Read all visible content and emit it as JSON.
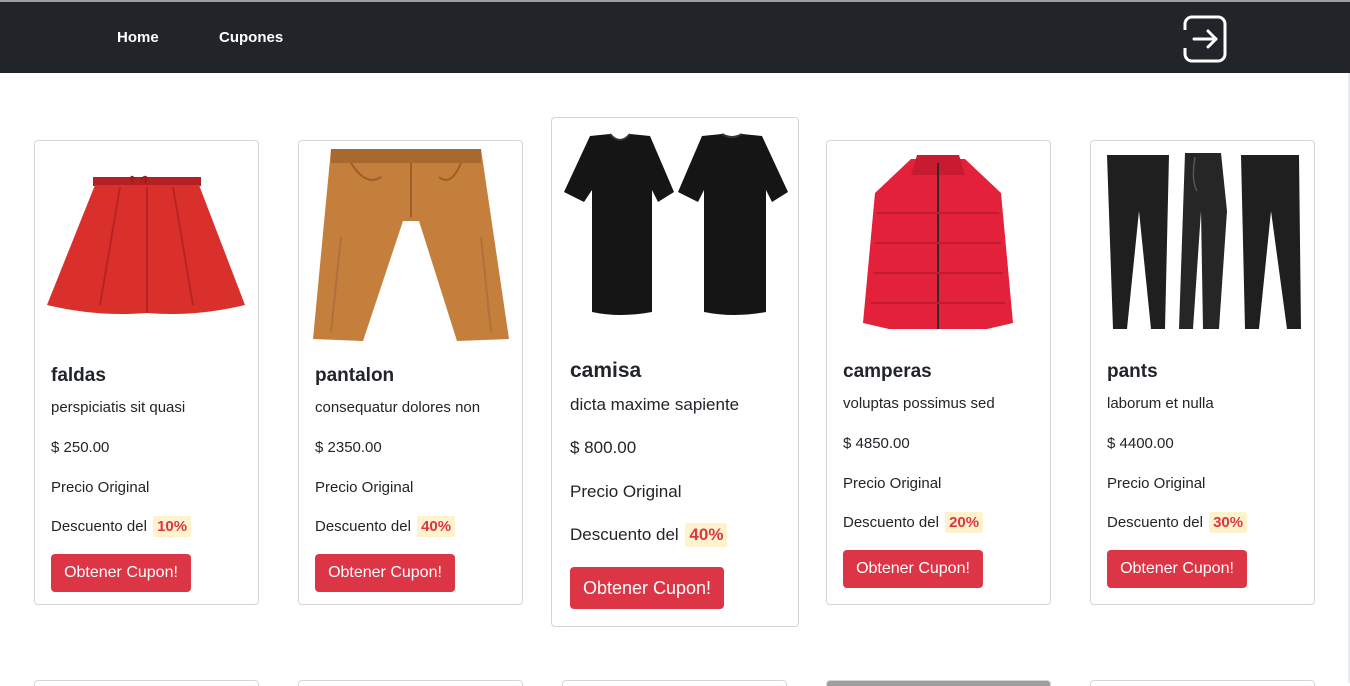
{
  "nav": {
    "home_label": "Home",
    "cupones_label": "Cupones",
    "logout_icon": "logout-icon"
  },
  "colors": {
    "navbar": "#212529",
    "button": "#dc3545",
    "discount_bg": "#fff3cd",
    "discount_text": "#dc3545"
  },
  "products": [
    {
      "title": "faldas",
      "description": "perspiciatis sit quasi",
      "price": "$ 250.00",
      "original": "Precio Original",
      "discount_label": "Descuento del",
      "discount": "10%",
      "button": "Obtener Cupon!",
      "image": "red-skirt"
    },
    {
      "title": "pantalon",
      "description": "consequatur dolores non",
      "price": "$ 2350.00",
      "original": "Precio Original",
      "discount_label": "Descuento del",
      "discount": "40%",
      "button": "Obtener Cupon!",
      "image": "brown-trousers"
    },
    {
      "title": "camisa",
      "description": "dicta maxime sapiente",
      "price": "$ 800.00",
      "original": "Precio Original",
      "discount_label": "Descuento del",
      "discount": "40%",
      "button": "Obtener Cupon!",
      "image": "black-tshirts"
    },
    {
      "title": "camperas",
      "description": "voluptas possimus sed",
      "price": "$ 4850.00",
      "original": "Precio Original",
      "discount_label": "Descuento del",
      "discount": "20%",
      "button": "Obtener Cupon!",
      "image": "red-puffer-jacket"
    },
    {
      "title": "pants",
      "description": "laborum et nulla",
      "price": "$ 4400.00",
      "original": "Precio Original",
      "discount_label": "Descuento del",
      "discount": "30%",
      "button": "Obtener Cupon!",
      "image": "black-joggers"
    }
  ]
}
